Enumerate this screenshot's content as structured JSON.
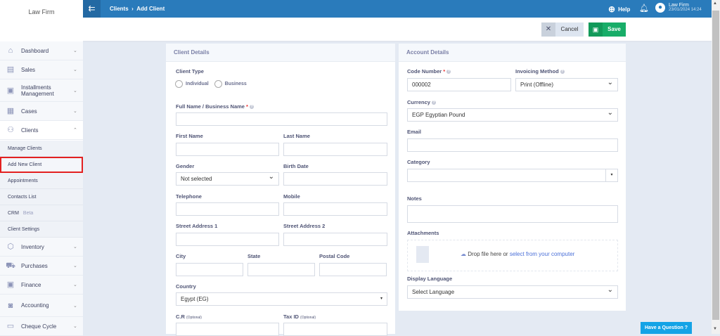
{
  "sidebar": {
    "brand": "Law Firm",
    "items": [
      {
        "label": "Dashboard",
        "icon": "home-icon"
      },
      {
        "label": "Sales",
        "icon": "receipt-icon"
      },
      {
        "label": "Installments Management",
        "icon": "installments-icon"
      },
      {
        "label": "Cases",
        "icon": "briefcase-icon"
      },
      {
        "label": "Clients",
        "icon": "users-icon"
      }
    ],
    "sub": [
      "Manage Clients",
      "Add New Client",
      "Appointments",
      "Contacts List",
      "CRM",
      "Client Settings"
    ],
    "crm_badge": "Beta",
    "items2": [
      {
        "label": "Inventory"
      },
      {
        "label": "Purchases"
      },
      {
        "label": "Finance"
      },
      {
        "label": "Accounting"
      },
      {
        "label": "Cheque Cycle"
      }
    ]
  },
  "topbar": {
    "breadcrumb": [
      "Clients",
      "Add Client"
    ],
    "help": "Help",
    "user": "Law Firm",
    "datetime": "23/01/2024 14:24"
  },
  "actions": {
    "cancel": "Cancel",
    "save": "Save"
  },
  "client": {
    "title": "Client Details",
    "client_type": "Client Type",
    "individual": "Individual",
    "business": "Business",
    "full_name": "Full Name / Business Name",
    "first_name": "First Name",
    "last_name": "Last Name",
    "gender": "Gender",
    "gender_value": "Not selected",
    "birth_date": "Birth Date",
    "telephone": "Telephone",
    "mobile": "Mobile",
    "street1": "Street Address 1",
    "street2": "Street Address 2",
    "city": "City",
    "state": "State",
    "postal": "Postal Code",
    "country": "Country",
    "country_value": "Egypt (EG)",
    "cr": "C.R",
    "tax": "Tax ID",
    "optional": "(Optional)"
  },
  "account": {
    "title": "Account Details",
    "code": "Code Number",
    "code_value": "000002",
    "invoicing": "Invoicing Method",
    "invoicing_value": "Print (Offline)",
    "currency": "Currency",
    "currency_value": "EGP Egyptian Pound",
    "email": "Email",
    "category": "Category",
    "notes": "Notes",
    "attachments": "Attachments",
    "drop": "Drop file here or",
    "select_link": "select from your computer",
    "display_lang": "Display Language",
    "lang_value": "Select Language"
  },
  "help_button": "Have a Question"
}
